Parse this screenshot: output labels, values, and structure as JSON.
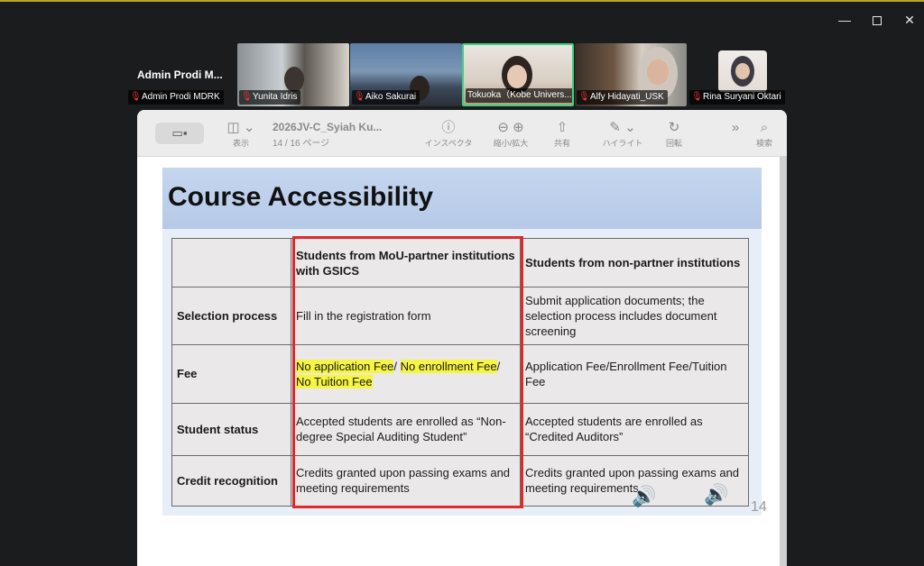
{
  "window": {
    "minimize": "—",
    "close": "✕"
  },
  "participants": [
    {
      "name": "Admin Prodi MDRK",
      "title": "Admin Prodi M...",
      "muted": true
    },
    {
      "name": "Yunita Idris",
      "muted": true
    },
    {
      "name": "Aiko Sakurai",
      "muted": true
    },
    {
      "name": "Tokuoka（Kobe Univers...",
      "muted": false
    },
    {
      "name": "Alfy Hidayati_USK",
      "muted": true
    },
    {
      "name": "Rina Suryani Oktari",
      "muted": true
    }
  ],
  "viewer": {
    "sidebar_label": "表示",
    "doc_title": "2026JV-C_Syiah Ku...",
    "page_info": "14 / 16 ページ",
    "inspector": "インスペクタ",
    "zoom": "縮小/拡大",
    "share": "共有",
    "highlight": "ハイライト",
    "rotate": "回転",
    "search": "検索"
  },
  "slide": {
    "title": "Course Accessibility",
    "columns": [
      "",
      "Students from MoU-partner institutions with GSICS",
      "Students from non-partner institutions"
    ],
    "rows": [
      {
        "label": "Selection process",
        "partner": "Fill in the registration form",
        "non_partner": "Submit application documents; the selection process includes document screening"
      },
      {
        "label": "Fee",
        "partner_parts": [
          "No application Fee",
          "/ ",
          "No enrollment Fee",
          "/ ",
          "No Tuition Fee"
        ],
        "non_partner": "Application Fee/Enrollment Fee/Tuition Fee"
      },
      {
        "label": "Student status",
        "partner": "Accepted students are enrolled as “Non-degree Special Auditing Student”",
        "non_partner": "Accepted students are enrolled as “Credited Auditors”"
      },
      {
        "label": "Credit recognition",
        "partner": "Credits granted upon passing exams and meeting requirements",
        "non_partner": "Credits granted upon passing exams and meeting requirements"
      }
    ],
    "audio": [
      "1",
      "2"
    ],
    "page_number": "14"
  }
}
